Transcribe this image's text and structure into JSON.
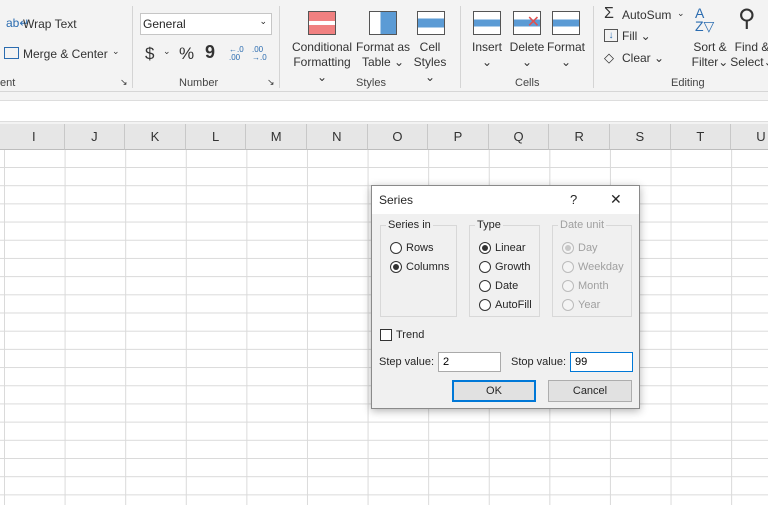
{
  "ribbon": {
    "alignment": {
      "wrap_text": "Wrap Text",
      "merge_center": "Merge & Center",
      "group_label": "ent"
    },
    "number": {
      "format_value": "General",
      "currency": "$",
      "percent": "%",
      "comma": "9",
      "inc_dec": "←.0 .00",
      "dec_dec": ".00 →.0",
      "group_label": "Number"
    },
    "styles": {
      "conditional_1": "Conditional",
      "conditional_2": "Formatting",
      "format_table_1": "Format as",
      "format_table_2": "Table",
      "cell_styles_1": "Cell",
      "cell_styles_2": "Styles",
      "group_label": "Styles"
    },
    "cells": {
      "insert": "Insert",
      "delete": "Delete",
      "format": "Format",
      "group_label": "Cells"
    },
    "editing": {
      "autosum": "AutoSum",
      "fill": "Fill",
      "clear": "Clear",
      "sort_1": "Sort &",
      "sort_2": "Filter",
      "find_1": "Find &",
      "find_2": "Select",
      "group_label": "Editing"
    }
  },
  "columns": [
    "I",
    "J",
    "K",
    "L",
    "M",
    "N",
    "O",
    "P",
    "Q",
    "R",
    "S",
    "T",
    "U"
  ],
  "dialog": {
    "title": "Series",
    "help": "?",
    "close": "✕",
    "series_in": {
      "label": "Series in",
      "options": [
        {
          "label": "Rows",
          "checked": false
        },
        {
          "label": "Columns",
          "checked": true
        }
      ]
    },
    "type": {
      "label": "Type",
      "options": [
        {
          "label": "Linear",
          "checked": true
        },
        {
          "label": "Growth",
          "checked": false
        },
        {
          "label": "Date",
          "checked": false
        },
        {
          "label": "AutoFill",
          "checked": false
        }
      ]
    },
    "date_unit": {
      "label": "Date unit",
      "options": [
        {
          "label": "Day",
          "checked": true
        },
        {
          "label": "Weekday",
          "checked": false
        },
        {
          "label": "Month",
          "checked": false
        },
        {
          "label": "Year",
          "checked": false
        }
      ]
    },
    "trend": "Trend",
    "step_label": "Step value:",
    "step_value": "2",
    "stop_label": "Stop value:",
    "stop_value": "99",
    "ok": "OK",
    "cancel": "Cancel"
  }
}
